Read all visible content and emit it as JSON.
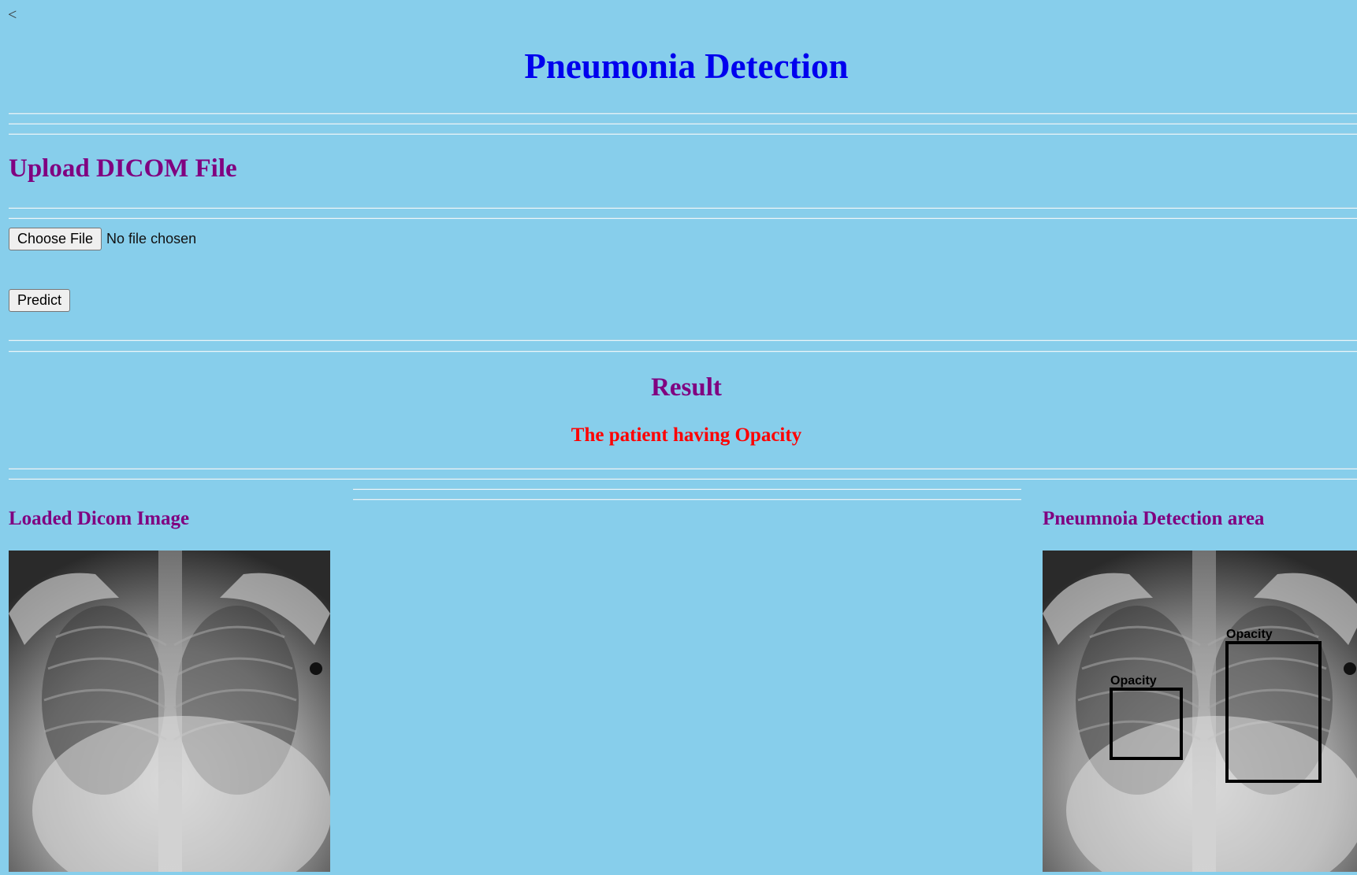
{
  "nav": {
    "back_label": "<"
  },
  "header": {
    "title": "Pneumonia Detection"
  },
  "upload": {
    "heading": "Upload DICOM File",
    "choose_label": "Choose File",
    "file_status": "No file chosen",
    "predict_label": "Predict"
  },
  "result": {
    "heading": "Result",
    "text": "The patient having Opacity"
  },
  "panels": {
    "loaded": {
      "caption": "Loaded Dicom Image"
    },
    "detection": {
      "caption": "Pneumnoia Detection area",
      "boxes": [
        {
          "label": "Opacity"
        },
        {
          "label": "Opacity"
        }
      ]
    }
  },
  "colors": {
    "background": "#87ceeb",
    "title": "#0000ee",
    "heading": "#800080",
    "result": "#ff0000"
  }
}
